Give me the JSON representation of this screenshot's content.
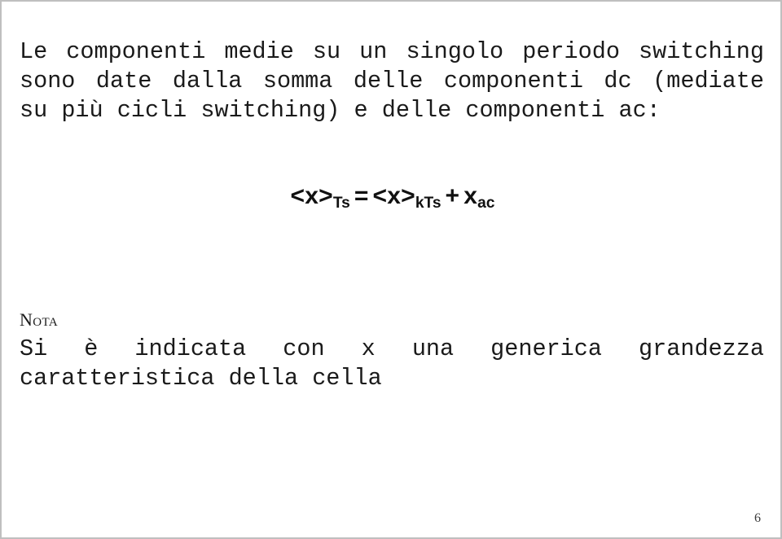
{
  "slide": {
    "page_number": "6",
    "background_color": "#ffffff",
    "border_color": "#bfbfbf",
    "text_color": "#1a1a1a"
  },
  "intro": {
    "full_text": "Le componenti medie su un singolo periodo switching sono date dalla somma delle componenti dc (mediate su più cicli switching) e delle componenti ac:",
    "lines": [
      {
        "justified": true,
        "words": [
          "Le",
          "componenti",
          "medie",
          "su",
          "un",
          "singolo",
          "periodo",
          "switching"
        ]
      },
      {
        "justified": true,
        "words": [
          "sono",
          "date",
          "dalla",
          "somma",
          "delle",
          "componenti",
          "dc",
          "(mediate"
        ]
      },
      {
        "justified": false,
        "words": [
          "su",
          "più",
          "cicli",
          "switching)",
          "e",
          "delle",
          "componenti",
          "ac:"
        ]
      }
    ]
  },
  "formula": {
    "plain": "<x>Ts = <x>kTs + xac",
    "parts": {
      "lhs_base": "<x>",
      "lhs_sub": "Ts",
      "equals": "=",
      "rhs1_base": "<x>",
      "rhs1_sub": "kTs",
      "plus": "+",
      "rhs2_base": "x",
      "rhs2_sub": "ac"
    }
  },
  "nota": {
    "heading": "Nota",
    "full_text": "Si è indicata con x una generica grandezza caratteristica della cella",
    "lines": [
      {
        "justified": true,
        "words": [
          "Si",
          "è",
          "indicata",
          "con",
          "x",
          "una",
          "generica",
          "grandezza"
        ]
      },
      {
        "justified": false,
        "words": [
          "caratteristica",
          "della",
          "cella"
        ]
      }
    ]
  }
}
